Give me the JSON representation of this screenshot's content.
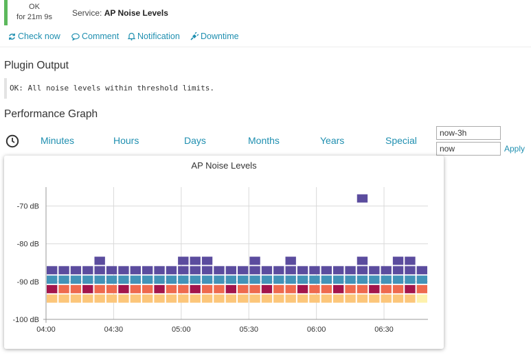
{
  "status": {
    "state": "OK",
    "duration": "for 21m 9s",
    "color": "#5cb85c"
  },
  "service": {
    "prefix": "Service:",
    "name": "AP Noise Levels"
  },
  "actions": [
    {
      "label": "Check now",
      "icon": "refresh-icon"
    },
    {
      "label": "Comment",
      "icon": "comment-icon"
    },
    {
      "label": "Notification",
      "icon": "bell-icon"
    },
    {
      "label": "Downtime",
      "icon": "plug-icon"
    }
  ],
  "plugin": {
    "title": "Plugin Output",
    "output": "OK: All noise levels within threshold limits."
  },
  "performance": {
    "title": "Performance Graph",
    "ranges": [
      "Minutes",
      "Hours",
      "Days",
      "Months",
      "Years",
      "Special"
    ],
    "from_value": "now-3h",
    "to_value": "now",
    "apply_label": "Apply"
  },
  "chart_data": {
    "type": "heatmap",
    "title": "AP Noise Levels",
    "xlabel": "",
    "ylabel": "",
    "x_ticks": [
      "04:00",
      "04:30",
      "05:00",
      "05:30",
      "06:00",
      "06:30"
    ],
    "y_ticks": [
      "-70 dB",
      "-80 dB",
      "-90 dB",
      "-100 dB"
    ],
    "ylim": [
      -100,
      -65
    ],
    "colors": [
      "#5b4c9e",
      "#4393b8",
      "#a3154b",
      "#ee6a4e",
      "#fcc67a",
      "#fef1ac"
    ],
    "series": [
      {
        "values": [
          -87,
          -87,
          -87,
          -87,
          -87,
          -87,
          -87,
          -87,
          -87,
          -87,
          -87,
          -87,
          -87,
          -87,
          -87,
          -87,
          -87,
          -87,
          -87,
          -87,
          -87,
          -87,
          -87,
          -87,
          -87,
          -87,
          -87,
          -87,
          -87,
          -87,
          -87,
          -87
        ]
      },
      {
        "values": [
          -89.5,
          -89.5,
          -89.5,
          -89.5,
          -89.5,
          -89.5,
          -89.5,
          -89.5,
          -89.5,
          -89.5,
          -89.5,
          -89.5,
          -89.5,
          -89.5,
          -89.5,
          -89.5,
          -89.5,
          -89.5,
          -89.5,
          -89.5,
          -89.5,
          -89.5,
          -89.5,
          -89.5,
          -89.5,
          -89.5,
          -89.5,
          -89.5,
          -89.5,
          -89.5,
          -89.5,
          -89.5
        ]
      },
      {
        "values": [
          -92,
          -92,
          -92,
          -92,
          -92,
          -92,
          -92,
          -92,
          -92,
          -92,
          -92,
          -92,
          -92,
          -92,
          -92,
          -92,
          -92,
          -92,
          -92,
          -92,
          -92,
          -92,
          -92,
          -92,
          -92,
          -92,
          -92,
          -92,
          -92,
          -92,
          -92,
          -92
        ]
      },
      {
        "values": [
          -94.5,
          -94.5,
          -94.5,
          -94.5,
          -94.5,
          -94.5,
          -94.5,
          -94.5,
          -94.5,
          -94.5,
          -94.5,
          -94.5,
          -94.5,
          -94.5,
          -94.5,
          -94.5,
          -94.5,
          -94.5,
          -94.5,
          -94.5,
          -94.5,
          -94.5,
          -94.5,
          -94.5,
          -94.5,
          -94.5,
          -94.5,
          -94.5,
          -94.5,
          -94.5,
          -94.5,
          -94.5
        ]
      }
    ],
    "extra_points": [
      {
        "slot": 4,
        "value": -84.5
      },
      {
        "slot": 11,
        "value": -84.5
      },
      {
        "slot": 12,
        "value": -84.5
      },
      {
        "slot": 13,
        "value": -84.5
      },
      {
        "slot": 17,
        "value": -84.5
      },
      {
        "slot": 20,
        "value": -84.5
      },
      {
        "slot": 26,
        "value": -84.5
      },
      {
        "slot": 26,
        "value": -68
      },
      {
        "slot": 29,
        "value": -84.5
      },
      {
        "slot": 30,
        "value": -84.5
      }
    ],
    "grid": true
  }
}
